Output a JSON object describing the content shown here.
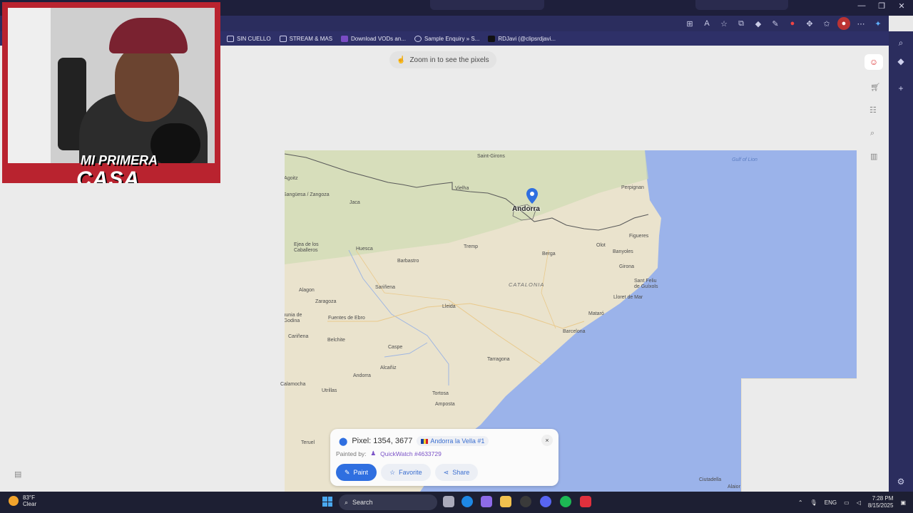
{
  "browser": {
    "bookmarks": [
      {
        "label": "SIN CUELLO",
        "icon": "folder-icon"
      },
      {
        "label": "STREAM & MAS",
        "icon": "folder-icon"
      },
      {
        "label": "Download VODs an...",
        "icon": "site-icon"
      },
      {
        "label": "Sample Enquiry » S...",
        "icon": "globe-icon"
      },
      {
        "label": "RDJavi (@clipsrdjavi...",
        "icon": "tiktok-icon"
      }
    ]
  },
  "page": {
    "zoom_hint": "Zoom in to see the pixels"
  },
  "map": {
    "pin_label": "Andorra",
    "region_label": "CATALONIA",
    "sea_label": "Gulf of Lion",
    "towns": [
      "Saint-Girons",
      "Aix / Agoitz",
      "Sangüesa / Zangoza",
      "Jaca",
      "Vielha",
      "Perpignan",
      "Figueres",
      "Ejea de los Caballeros",
      "Huesca",
      "Tremp",
      "Olot",
      "Banyoles",
      "Berga",
      "Barbastro",
      "Girona",
      "Sant Feliu de Guíxols",
      "Lloret de Mar",
      "Alagon",
      "Sariñena",
      "Zaragoza",
      "Lleida",
      "Mataró",
      "La Almunia de Doña Godina",
      "Fuentes de Ebro",
      "Barcelona",
      "Cariñena",
      "Belchite",
      "Caspe",
      "Alcañiz",
      "Tarragona",
      "Andorra",
      "Calamocha",
      "Utrillas",
      "Tortosa",
      "Amposta",
      "Teruel",
      "Ciutadella",
      "Alaior"
    ]
  },
  "pixel_panel": {
    "pixel_text": "Pixel: 1354, 3677",
    "location_chip": "Andorra la Vella #1",
    "painted_by_label": "Painted by:",
    "painter": "QuickWatch #4633729",
    "close_label": "×",
    "paint_label": "Paint",
    "favorite_label": "Favorite",
    "share_label": "Share"
  },
  "webcam": {
    "overlay_line1": "MI PRIMERA",
    "overlay_line2": "CASA"
  },
  "taskbar": {
    "weather_temp": "83°F",
    "weather_desc": "Clear",
    "search_label": "Search",
    "lang": "ENG",
    "time": "7:28 PM",
    "date": "8/15/2025"
  },
  "colors": {
    "accent": "#2f6fe0",
    "sea": "#9bb3ea",
    "land": "#eae3cd",
    "border": "#555555",
    "chrome": "#2b2d5e"
  }
}
